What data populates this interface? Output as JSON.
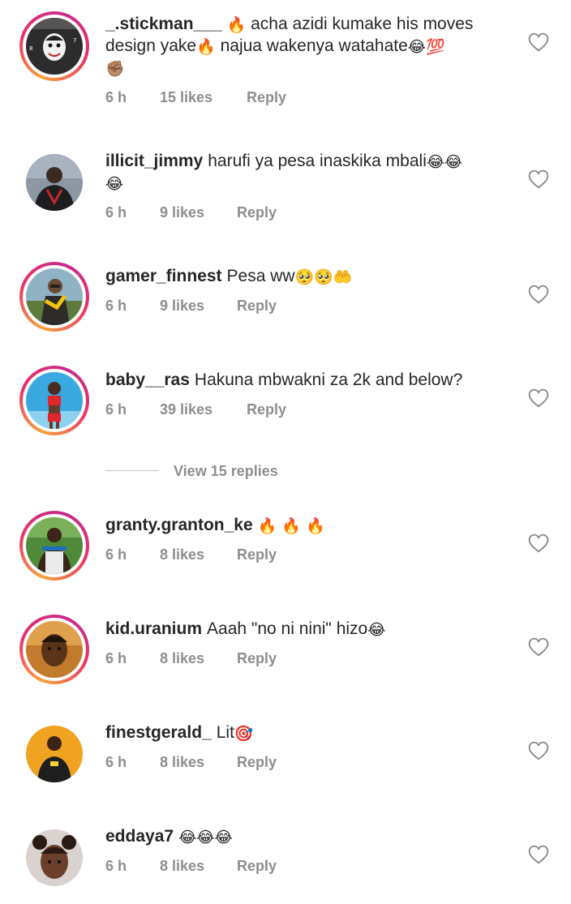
{
  "comments": [
    {
      "username": "_.stickman___",
      "text": "acha azidi kumake his moves design yake",
      "text2": "najua wakenya watahate",
      "emoji_lead": "🔥",
      "emoji_mid": "🔥",
      "emoji_end": "😂💯",
      "emoji_line2": "✊🏽",
      "time": "6 h",
      "likes": "15 likes",
      "reply": "Reply"
    },
    {
      "username": "illicit_jimmy",
      "text": "harufi ya pesa inaskika mbali",
      "emoji_end": "😂😂",
      "emoji_line2": "😂",
      "time": "6 h",
      "likes": "9 likes",
      "reply": "Reply"
    },
    {
      "username": "gamer_finnest",
      "text": "Pesa ww",
      "emoji_end": "🥺🥺🤲",
      "time": "6 h",
      "likes": "9 likes",
      "reply": "Reply"
    },
    {
      "username": "baby__ras",
      "text": "Hakuna mbwakni za 2k and below?",
      "time": "6 h",
      "likes": "39 likes",
      "reply": "Reply"
    },
    {
      "username": "granty.granton_ke",
      "text": "",
      "emoji_end": "🔥 🔥 🔥",
      "time": "6 h",
      "likes": "8 likes",
      "reply": "Reply"
    },
    {
      "username": "kid.uranium",
      "text": "Aaah \"no ni nini\" hizo",
      "emoji_end": "😂",
      "time": "6 h",
      "likes": "8 likes",
      "reply": "Reply"
    },
    {
      "username": "finestgerald_",
      "text": "Lit",
      "emoji_end": "🎯",
      "time": "6 h",
      "likes": "8 likes",
      "reply": "Reply"
    },
    {
      "username": "eddaya7",
      "text": "",
      "emoji_end": "😂😂😂",
      "time": "6 h",
      "likes": "8 likes",
      "reply": "Reply"
    }
  ],
  "view_replies": "View 15 replies",
  "colors": {
    "text": "#262626",
    "meta": "#8e8e8e",
    "story_ring_start": "#f9a13a",
    "story_ring_end": "#c72a8c"
  },
  "icons": {
    "like": "heart-outline-icon"
  }
}
